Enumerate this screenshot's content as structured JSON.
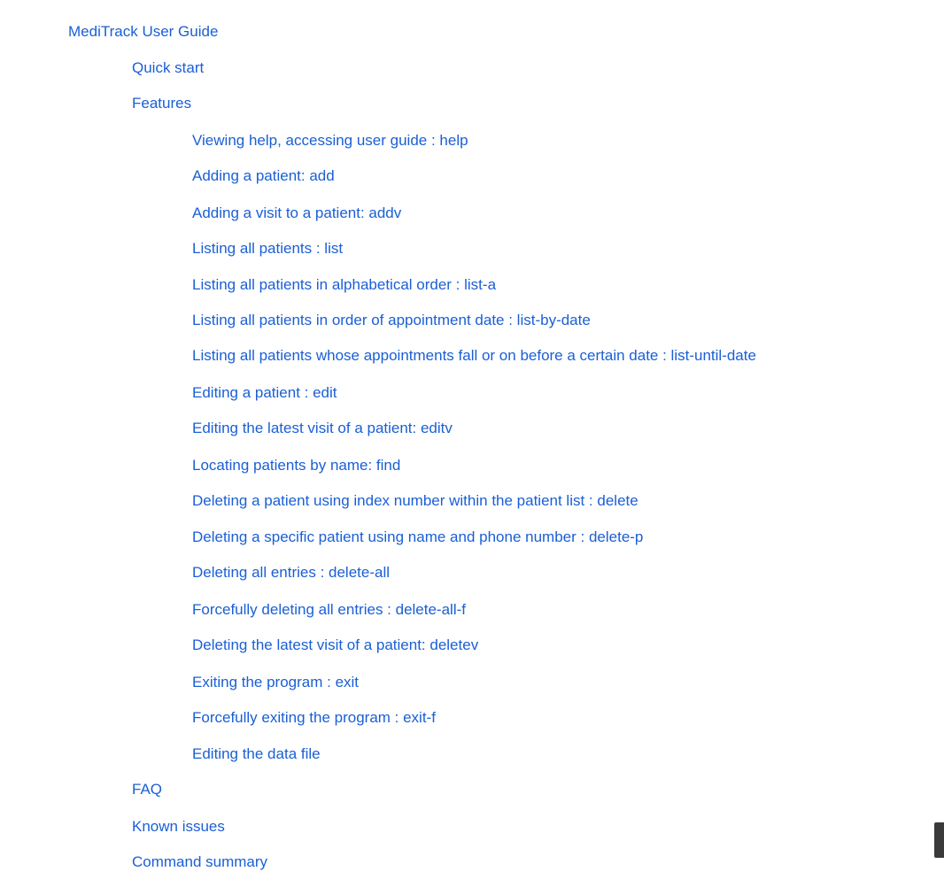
{
  "toc": {
    "title": "MediTrack User Guide",
    "quick_start": "Quick start",
    "features": "Features",
    "feature_items": [
      "Viewing help, accessing user guide : help",
      "Adding a patient: add",
      "Adding a visit to a patient: addv",
      "Listing all patients : list",
      "Listing all patients in alphabetical order : list-a",
      "Listing all patients in order of appointment date : list-by-date",
      "Listing all patients whose appointments fall or on before a certain date : list-until-date",
      "Editing a patient : edit",
      "Editing the latest visit of a patient: editv",
      "Locating patients by name: find",
      "Deleting a patient using index number within the patient list : delete",
      "Deleting a specific patient using name and phone number : delete-p",
      "Deleting all entries : delete-all",
      "Forcefully deleting all entries : delete-all-f",
      "Deleting the latest visit of a patient: deletev",
      "Exiting the program : exit",
      "Forcefully exiting the program : exit-f",
      "Editing the data file"
    ],
    "faq": "FAQ",
    "known_issues": "Known issues",
    "command_summary": "Command summary"
  },
  "colors": {
    "link": "#1a5fd6",
    "background": "#ffffff"
  }
}
